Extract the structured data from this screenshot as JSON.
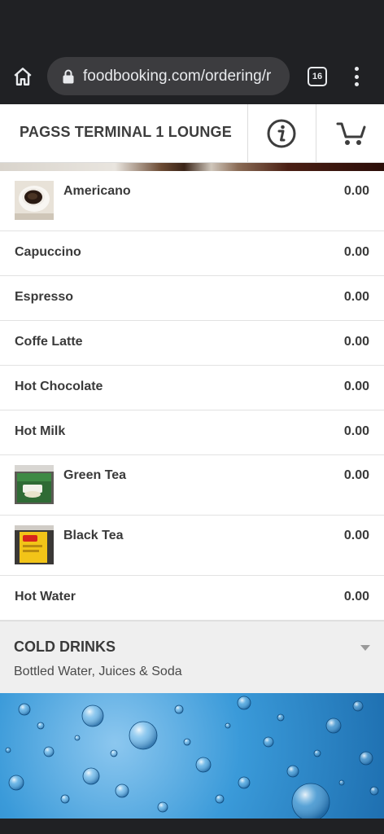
{
  "browser": {
    "url": "foodbooking.com/ordering/r",
    "tab_count": "16"
  },
  "header": {
    "venue_name": "PAGSS TERMINAL 1 LOUNGE"
  },
  "items": [
    {
      "name": "Americano",
      "price": "0.00"
    },
    {
      "name": "Capuccino",
      "price": "0.00"
    },
    {
      "name": "Espresso",
      "price": "0.00"
    },
    {
      "name": "Coffe Latte",
      "price": "0.00"
    },
    {
      "name": "Hot Chocolate",
      "price": "0.00"
    },
    {
      "name": "Hot Milk",
      "price": "0.00"
    },
    {
      "name": "Green Tea",
      "price": "0.00"
    },
    {
      "name": "Black Tea",
      "price": "0.00"
    },
    {
      "name": "Hot Water",
      "price": "0.00"
    }
  ],
  "category": {
    "title": "COLD DRINKS",
    "subtitle": "Bottled Water, Juices & Soda"
  },
  "colors": {
    "browser_chrome": "#202124",
    "url_pill": "#3c3c3f",
    "text_dark": "#3a3a3a",
    "category_bg": "#efefef"
  }
}
